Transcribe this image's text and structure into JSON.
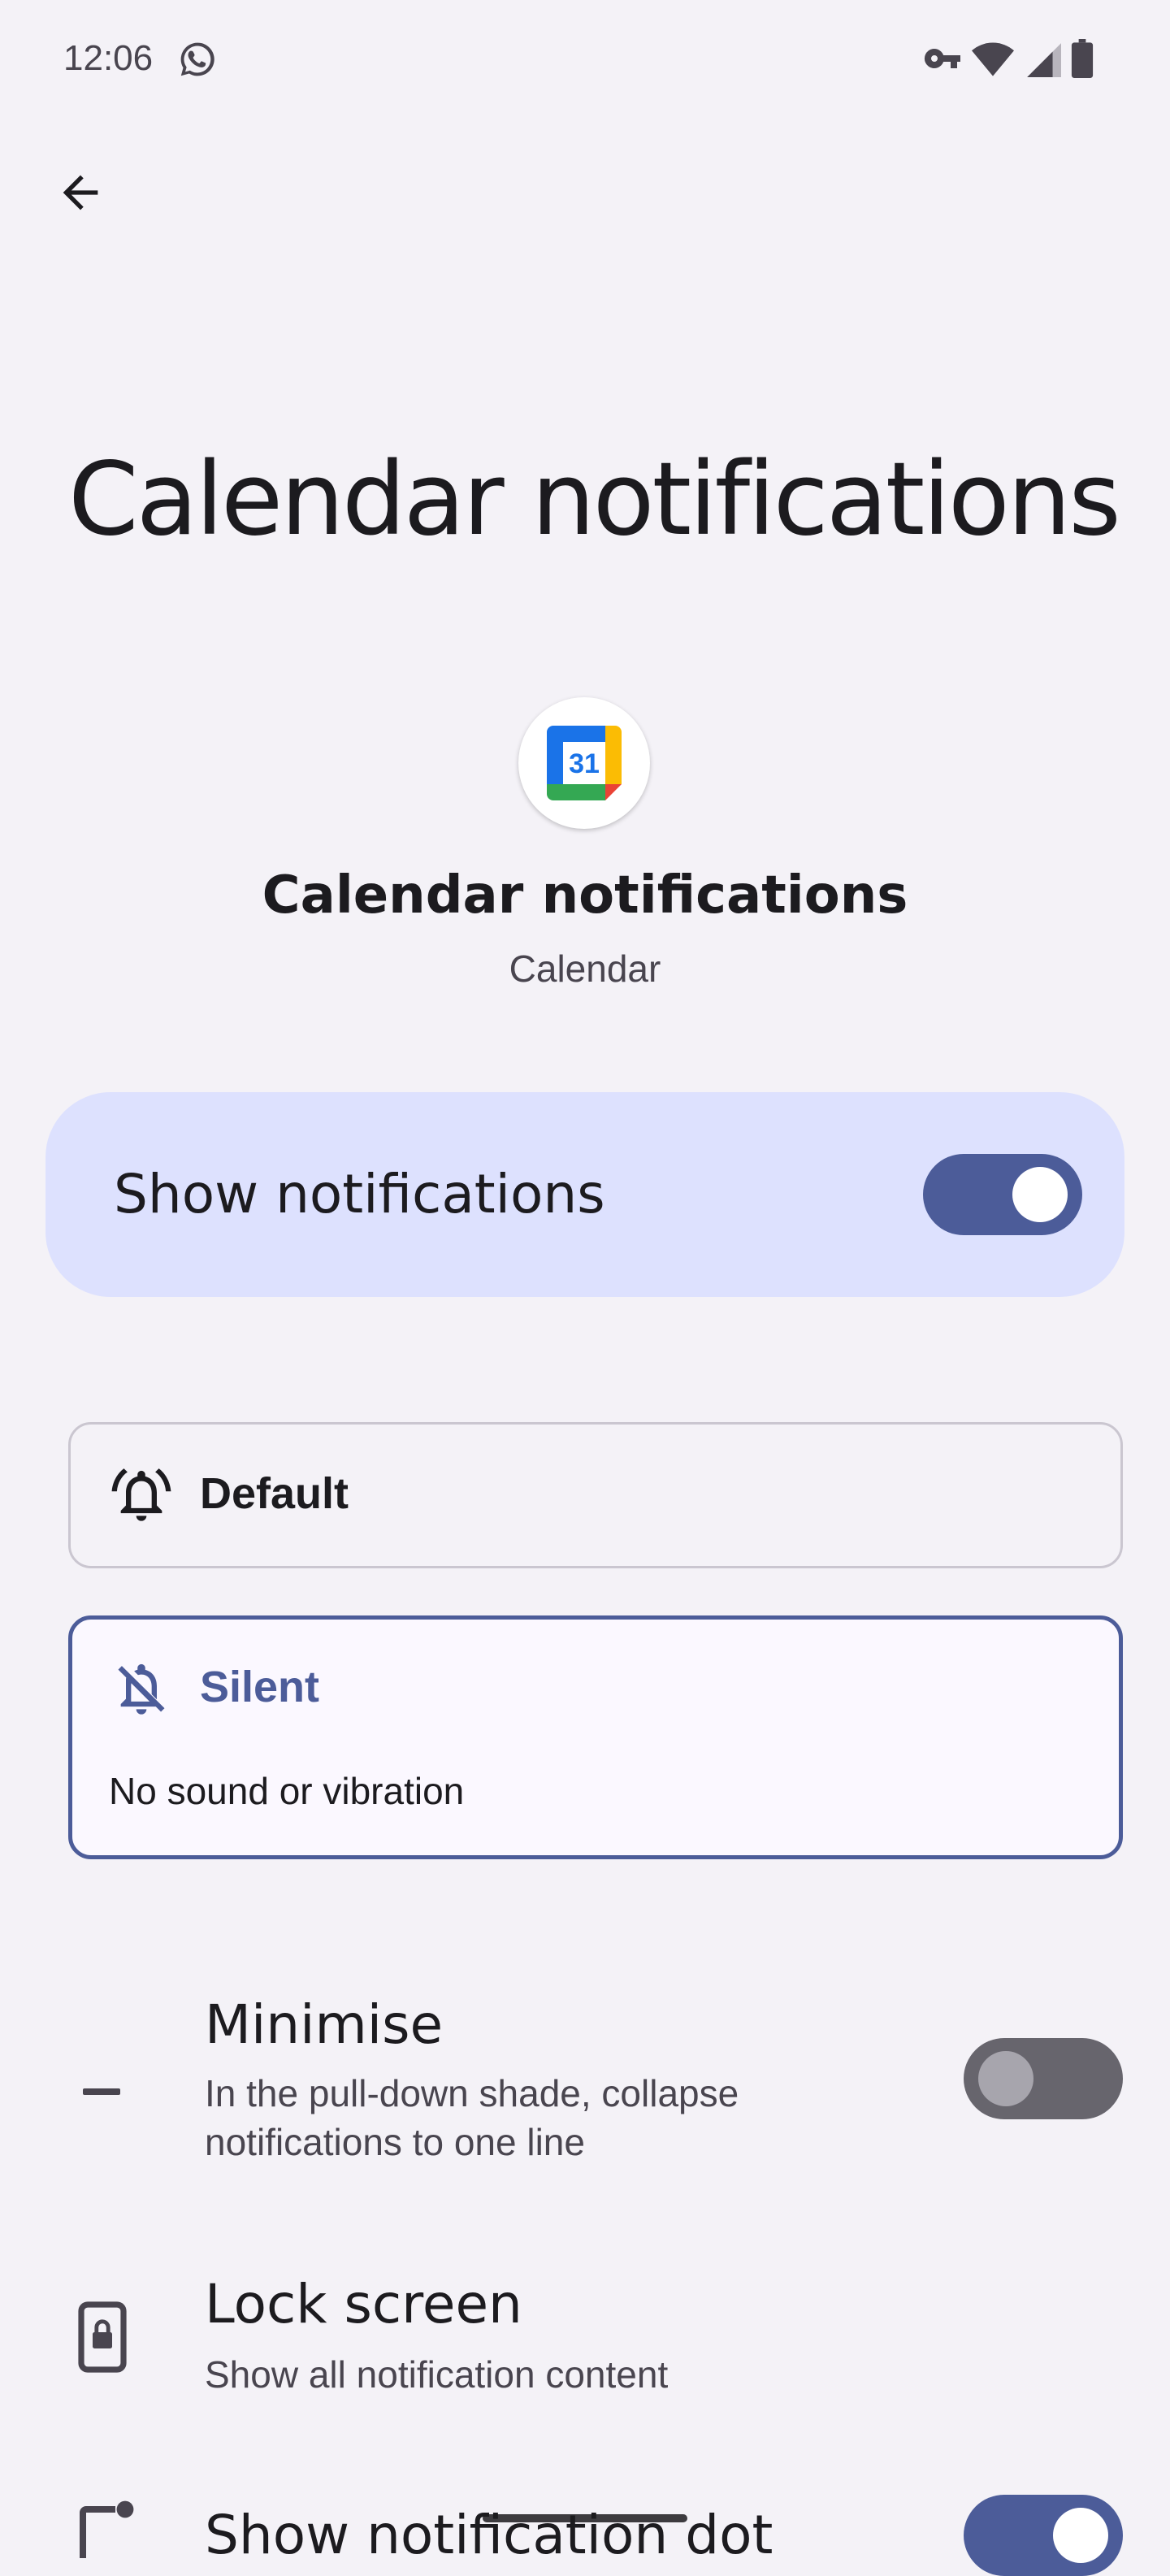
{
  "status_bar": {
    "time": "12:06",
    "notification_icons": [
      "whatsapp-icon"
    ],
    "system_icons": [
      "vpn-key-icon",
      "wifi-icon",
      "cellular-signal-icon",
      "battery-icon"
    ]
  },
  "header": {
    "back_icon": "arrow-back-icon",
    "title": "Calendar notifications"
  },
  "channel": {
    "app_icon": "google-calendar-icon",
    "icon_day": "31",
    "name": "Calendar notifications",
    "app": "Calendar"
  },
  "show_notifications": {
    "label": "Show notifications",
    "enabled": true
  },
  "alert_options": {
    "default": {
      "label": "Default",
      "icon": "bell-icon",
      "selected": false
    },
    "silent": {
      "label": "Silent",
      "icon": "bell-off-icon",
      "description": "No sound or vibration",
      "selected": true
    }
  },
  "settings": {
    "minimise": {
      "title": "Minimise",
      "subtitle_line1": "In the pull-down shade, collapse",
      "subtitle_line2": "notifications to one line",
      "icon": "minimise-dash-icon",
      "enabled": false
    },
    "lock_screen": {
      "title": "Lock screen",
      "subtitle": "Show all notification content",
      "icon": "lock-screen-phone-icon"
    },
    "notification_dot": {
      "title": "Show notification dot",
      "icon": "notification-dot-icon",
      "enabled": true
    }
  },
  "colors": {
    "background": "#f4f2f7",
    "accent": "#4c5c99",
    "master_card": "#dde1fe",
    "switch_off_track": "#67656d"
  }
}
